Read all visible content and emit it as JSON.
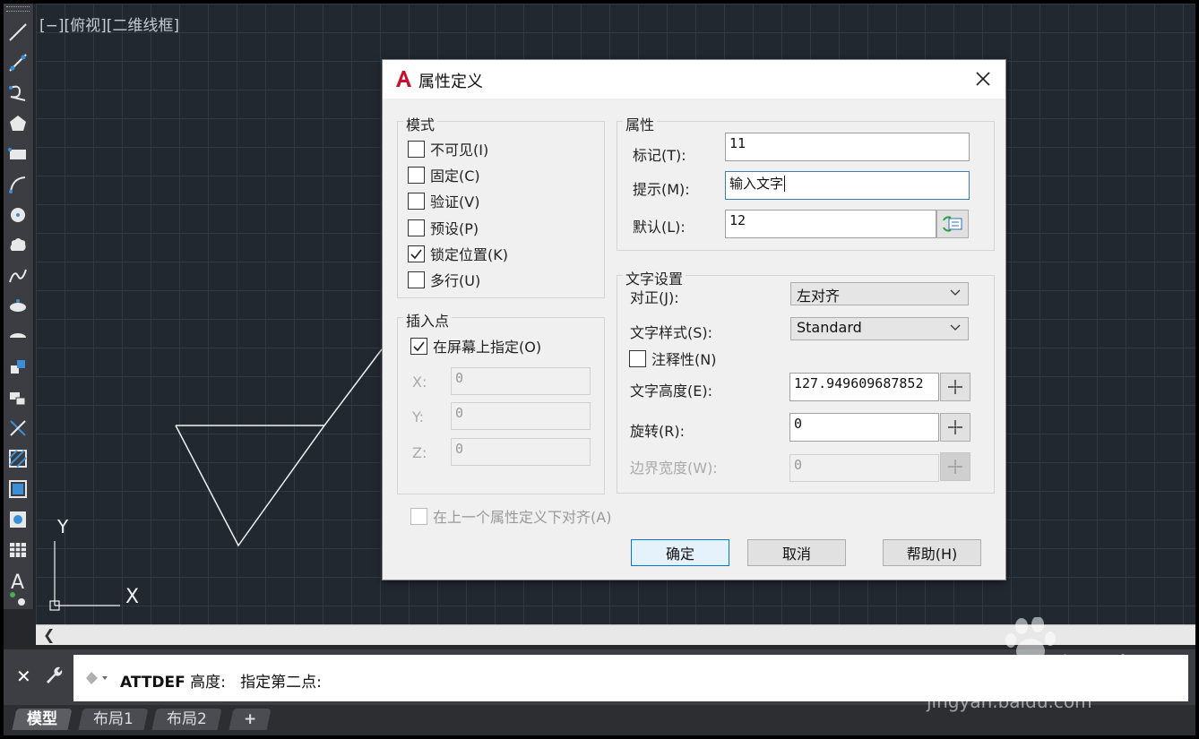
{
  "viewport": {
    "label": "[−][俯视][二维线框]"
  },
  "axis": {
    "y": "Y",
    "x": "X"
  },
  "dialog": {
    "title": "属性定义",
    "mode": {
      "title": "模式",
      "items": [
        {
          "label": "不可见(I)",
          "checked": false
        },
        {
          "label": "固定(C)",
          "checked": false
        },
        {
          "label": "验证(V)",
          "checked": false
        },
        {
          "label": "预设(P)",
          "checked": false
        },
        {
          "label": "锁定位置(K)",
          "checked": true
        },
        {
          "label": "多行(U)",
          "checked": false
        }
      ]
    },
    "insert": {
      "title": "插入点",
      "on_screen": {
        "label": "在屏幕上指定(O)",
        "checked": true
      },
      "x_label": "X:",
      "y_label": "Y:",
      "z_label": "Z:",
      "x_value": "0",
      "y_value": "0",
      "z_value": "0"
    },
    "attribute": {
      "title": "属性",
      "tag_label": "标记(T):",
      "tag_value": "11",
      "prompt_label": "提示(M):",
      "prompt_value": "输入文字",
      "default_label": "默认(L):",
      "default_value": "12"
    },
    "text": {
      "title": "文字设置",
      "justify_label": "对正(J):",
      "justify_value": "左对齐",
      "style_label": "文字样式(S):",
      "style_value": "Standard",
      "annotative_label": "注释性(N)",
      "annotative_checked": false,
      "height_label": "文字高度(E):",
      "height_value": "127.949609687852",
      "rotation_label": "旋转(R):",
      "rotation_value": "0",
      "width_label": "边界宽度(W):",
      "width_value": "0"
    },
    "align_below": "在上一个属性定义下对齐(A)",
    "buttons": {
      "ok": "确定",
      "cancel": "取消",
      "help": "帮助(H)"
    }
  },
  "command": {
    "keyword": "ATTDEF",
    "text": " 高度:   指定第二点:"
  },
  "tabs": [
    {
      "label": "模型",
      "active": true
    },
    {
      "label": "布局1",
      "active": false
    },
    {
      "label": "布局2",
      "active": false
    },
    {
      "label": "+",
      "active": false
    }
  ],
  "watermark": {
    "brand": "Baidu经验",
    "url": "jingyan.baidu.com"
  }
}
